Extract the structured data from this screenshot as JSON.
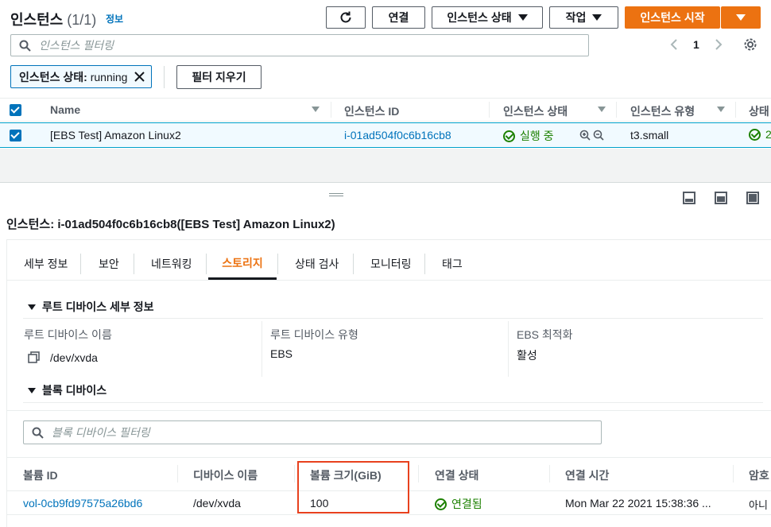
{
  "header": {
    "title": "인스턴스",
    "count": "(1/1)",
    "info": "정보"
  },
  "toolbar": {
    "connect": "연결",
    "instance_state": "인스턴스 상태",
    "actions": "작업",
    "launch": "인스턴스 시작"
  },
  "search": {
    "placeholder": "인스턴스 필터링"
  },
  "pagination": {
    "page": "1"
  },
  "filter": {
    "key": "인스턴스 상태:",
    "value": "running",
    "clear": "필터 지우기"
  },
  "table": {
    "headers": [
      "Name",
      "인스턴스 ID",
      "인스턴스 상태",
      "인스턴스 유형",
      "상태"
    ],
    "row": {
      "name": "[EBS Test] Amazon Linux2",
      "id": "i-01ad504f0c6b16cb8",
      "state": "실행 중",
      "type": "t3.small",
      "status": "2"
    }
  },
  "detail": {
    "title": "인스턴스: i-01ad504f0c6b16cb8([EBS Test] Amazon Linux2)",
    "tabs": [
      "세부 정보",
      "보안",
      "네트워킹",
      "스토리지",
      "상태 검사",
      "모니터링",
      "태그"
    ],
    "root_section": "루트 디바이스 세부 정보",
    "root_device_name_label": "루트 디바이스 이름",
    "root_device_name": "/dev/xvda",
    "root_device_type_label": "루트 디바이스 유형",
    "root_device_type": "EBS",
    "ebs_opt_label": "EBS 최적화",
    "ebs_opt": "활성",
    "block_section": "블록 디바이스",
    "block_placeholder": "블록 디바이스 필터링"
  },
  "block_table": {
    "headers": [
      "볼륨 ID",
      "디바이스 이름",
      "볼륨 크기(GiB)",
      "연결 상태",
      "연결 시간",
      "암호"
    ],
    "row": {
      "volume_id": "vol-0cb9fd97575a26bd6",
      "device": "/dev/xvda",
      "size": "100",
      "attach_state": "연결됨",
      "attach_time": "Mon Mar 22 2021 15:38:36 ...",
      "encrypted": "아니"
    }
  },
  "colors": {
    "accent": "#ec7211",
    "link": "#0073bb",
    "ok": "#1d8102",
    "highlight": "#e8411e"
  }
}
